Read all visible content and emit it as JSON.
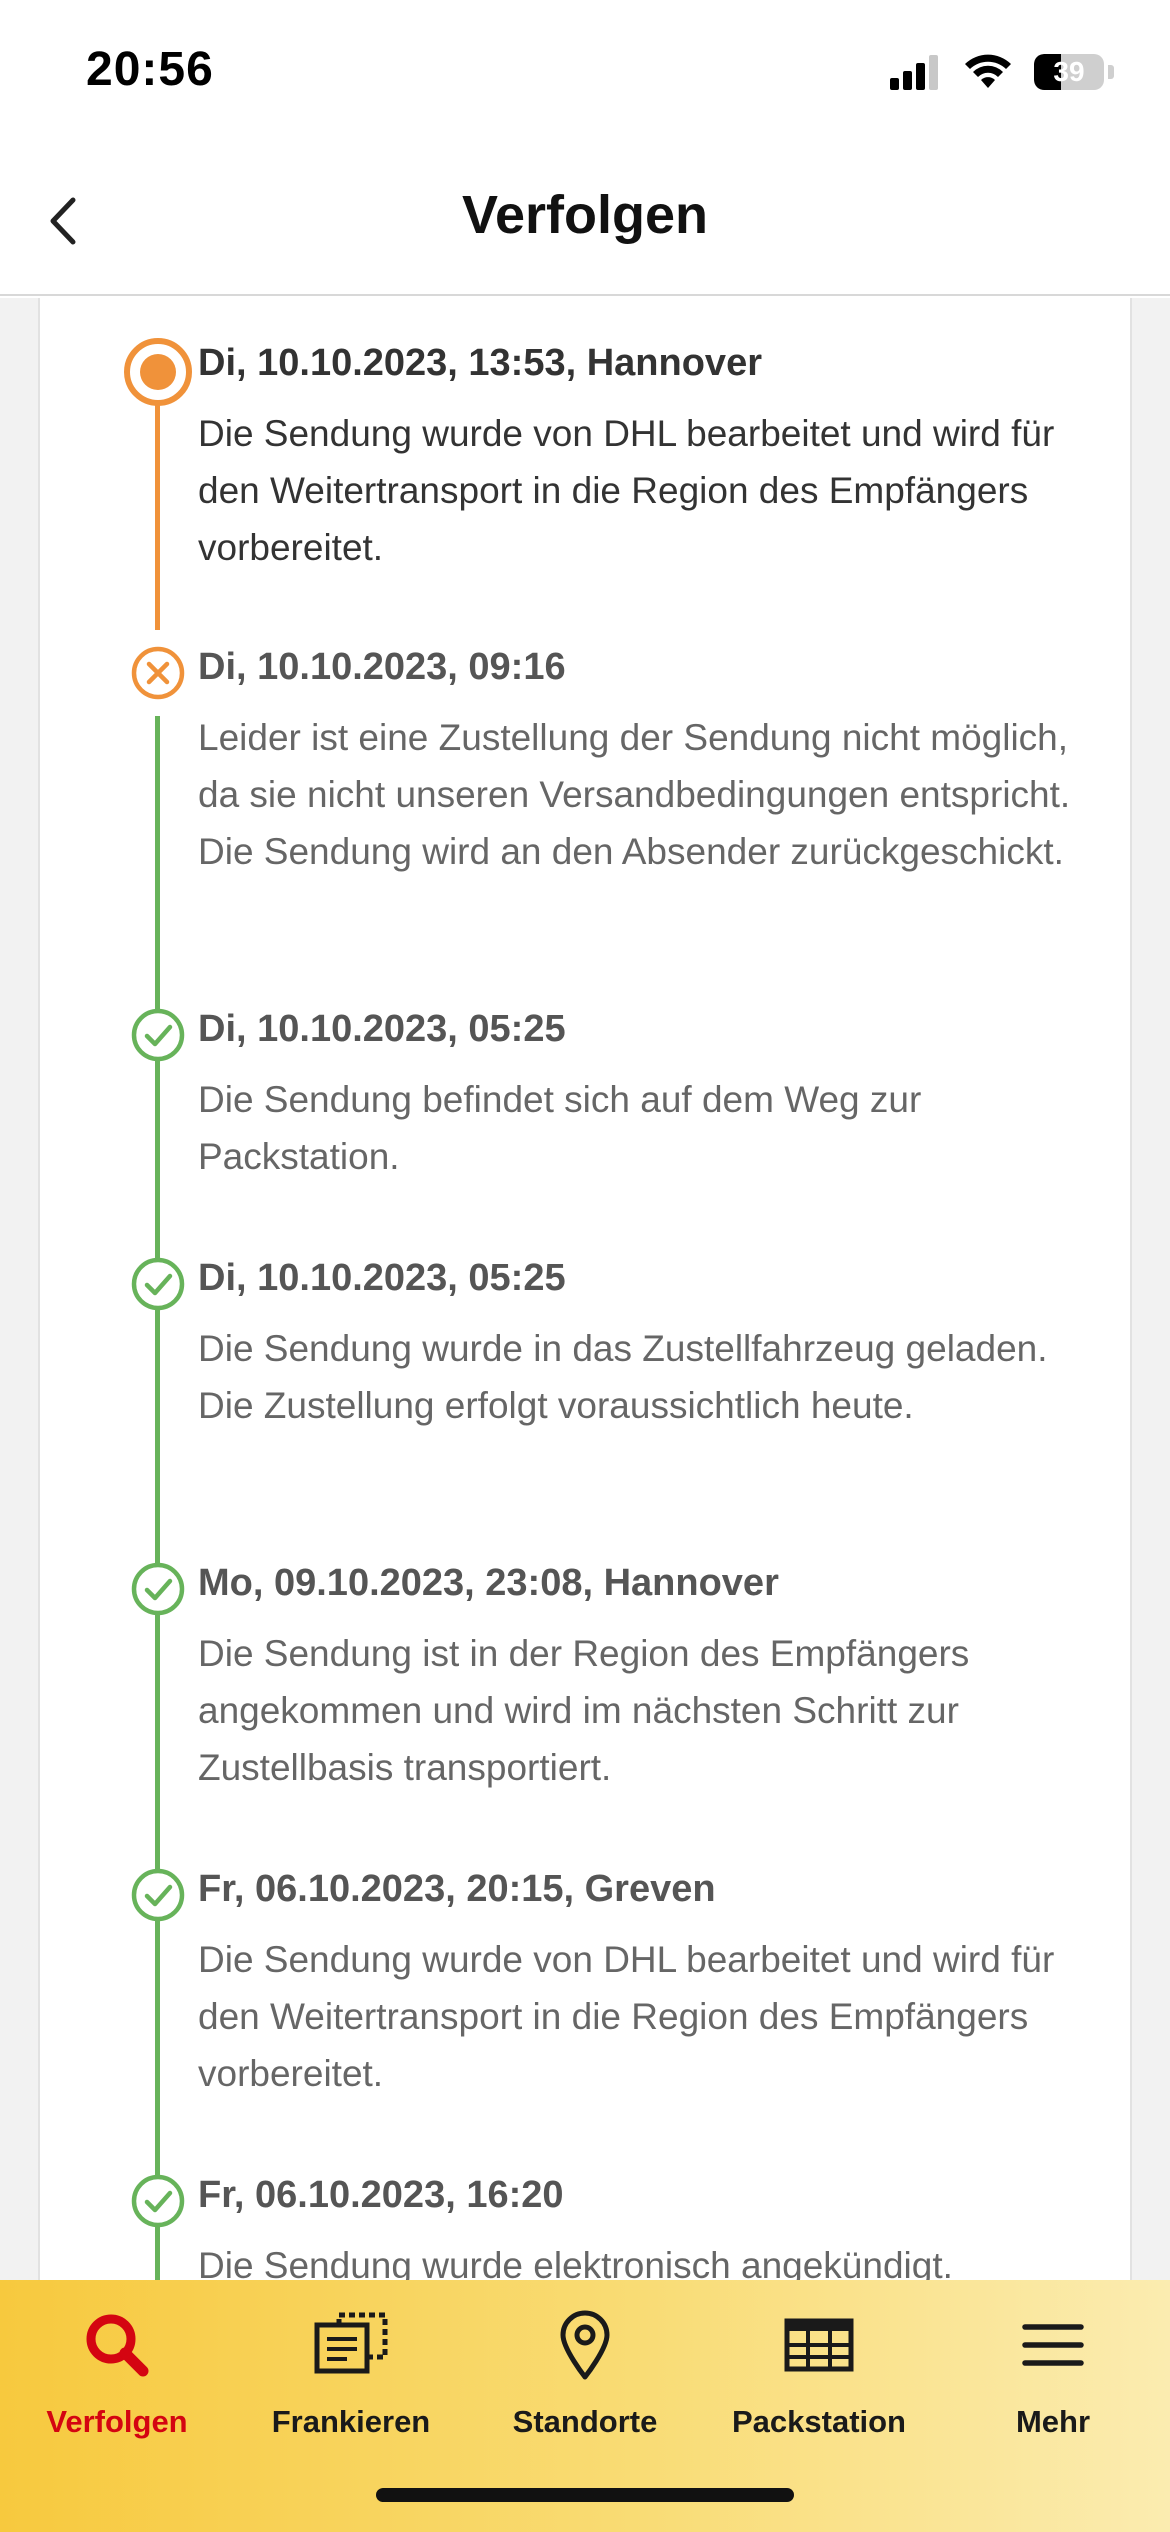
{
  "status_bar": {
    "time": "20:56",
    "battery": "39",
    "battery_level": 0.39
  },
  "header": {
    "title": "Verfolgen"
  },
  "colors": {
    "active_orange": "#f0923a",
    "done_green": "#67b35a",
    "dhl_red": "#d40511",
    "dhl_yellow": "#f7c93e"
  },
  "events": [
    {
      "status": "current",
      "title": "Di, 10.10.2023, 13:53, Hannover",
      "description": "Die Sendung wurde von DHL bearbeitet und wird für den Weitertransport in die Region des Empfängers vorbereitet."
    },
    {
      "status": "failed",
      "title": "Di, 10.10.2023, 09:16",
      "description": "Leider ist eine Zustellung der Sendung nicht möglich, da sie nicht unseren Versandbedingungen entspricht. Die Sendung wird an den Absender zurückgeschickt."
    },
    {
      "status": "done",
      "title": "Di, 10.10.2023, 05:25",
      "description": "Die Sendung befindet sich auf dem Weg zur Packstation."
    },
    {
      "status": "done",
      "title": "Di, 10.10.2023, 05:25",
      "description": "Die Sendung wurde in das Zustellfahrzeug geladen. Die Zustellung erfolgt voraussichtlich heute."
    },
    {
      "status": "done",
      "title": "Mo, 09.10.2023, 23:08, Hannover",
      "description": "Die Sendung ist in der Region des Empfängers angekommen und wird im nächsten Schritt zur Zustellbasis transportiert."
    },
    {
      "status": "done",
      "title": "Fr, 06.10.2023, 20:15, Greven",
      "description": "Die Sendung wurde von DHL bearbeitet und wird für den Weitertransport in die Region des Empfängers vorbereitet."
    },
    {
      "status": "done",
      "title": "Fr, 06.10.2023, 16:20",
      "description": "Die Sendung wurde elektronisch angekündigt."
    }
  ],
  "tabs": [
    {
      "label": "Verfolgen",
      "icon": "search-icon",
      "active": true
    },
    {
      "label": "Frankieren",
      "icon": "stamp-icon",
      "active": false
    },
    {
      "label": "Standorte",
      "icon": "location-pin-icon",
      "active": false
    },
    {
      "label": "Packstation",
      "icon": "packstation-icon",
      "active": false
    },
    {
      "label": "Mehr",
      "icon": "menu-icon",
      "active": false
    }
  ]
}
